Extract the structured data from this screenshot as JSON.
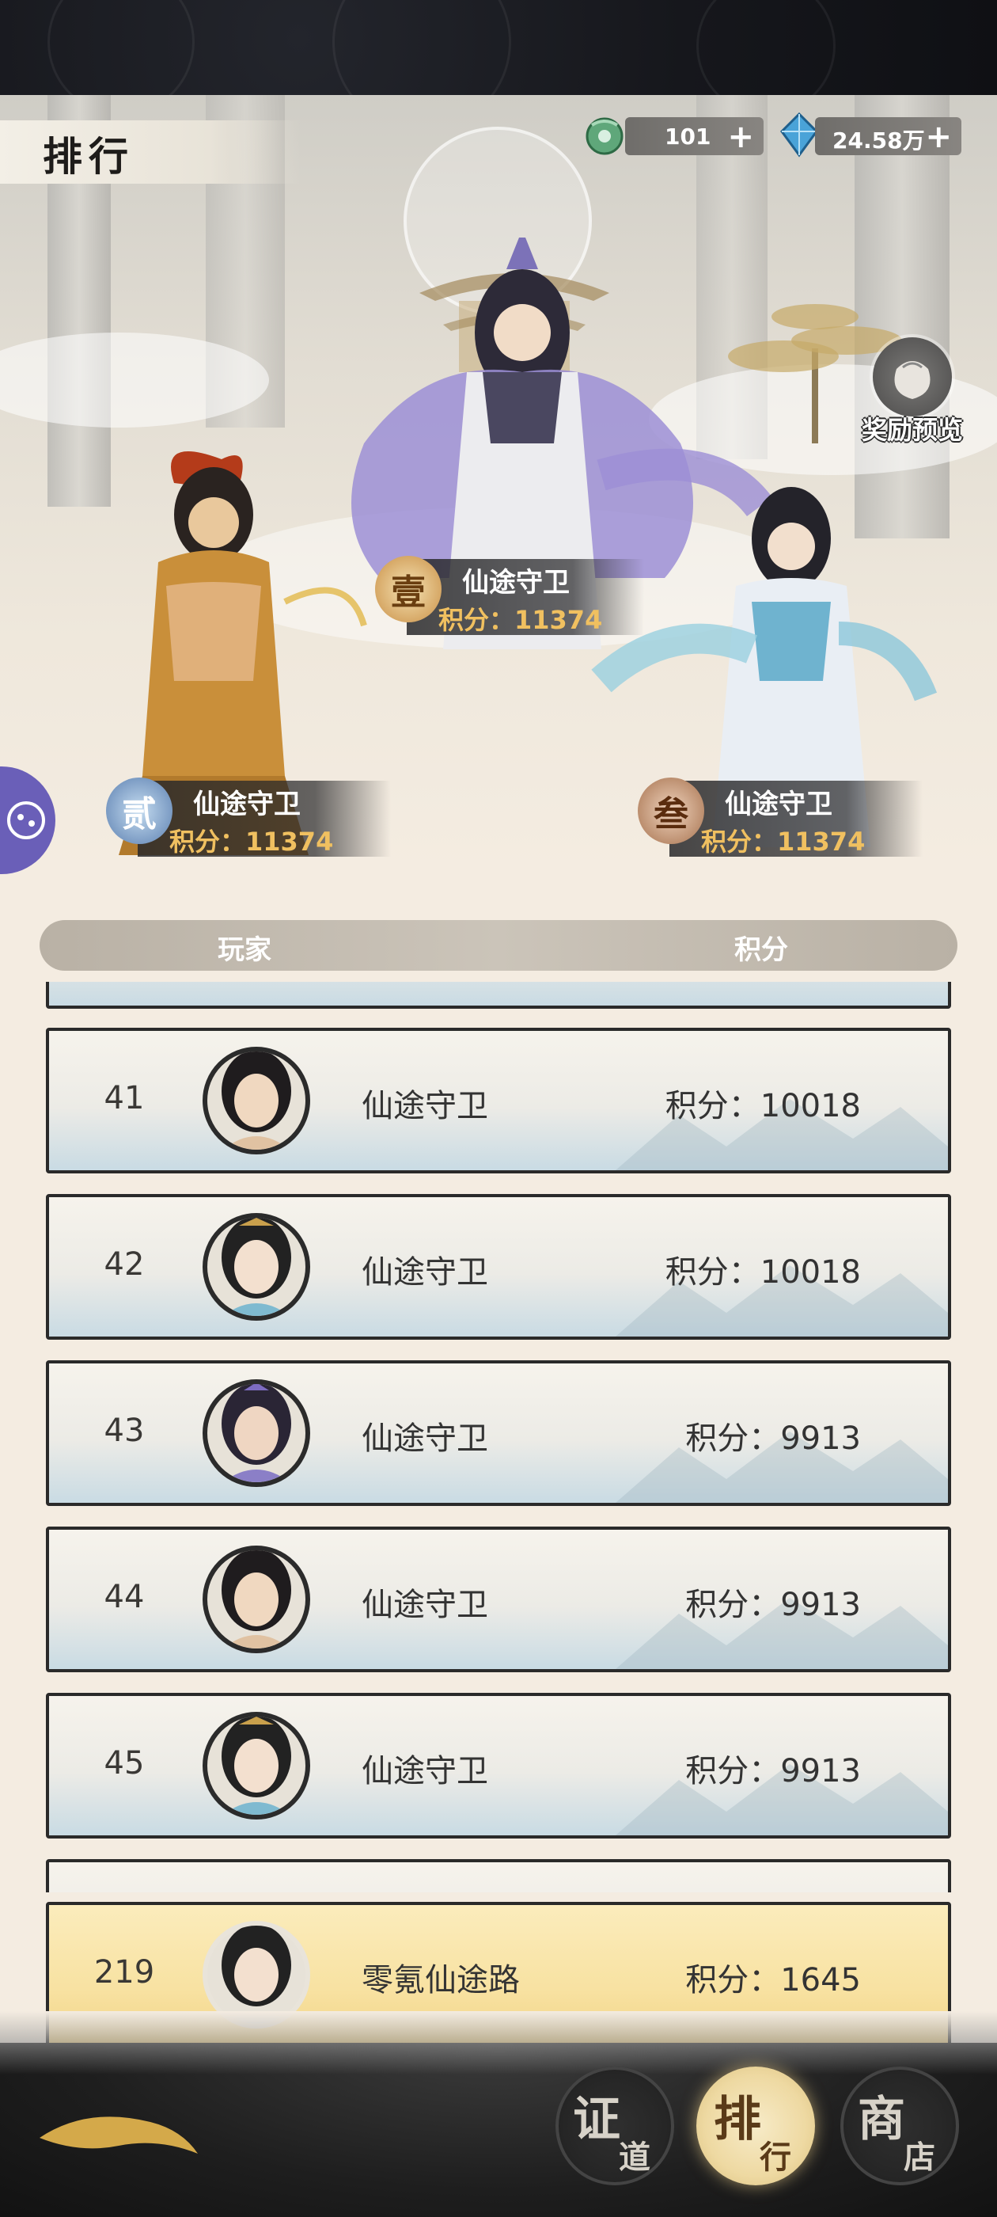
{
  "screen": {
    "title": "排行"
  },
  "currencies": [
    {
      "icon": "jade-coin-icon",
      "value": "101",
      "plus": "+"
    },
    {
      "icon": "spirit-crystal-icon",
      "value": "24.58万",
      "plus": "+"
    }
  ],
  "reward_preview": {
    "label": "奖励预览",
    "icon": "reward-bag-icon"
  },
  "podium": [
    {
      "rank_glyph": "壹",
      "name": "仙途守卫",
      "score": "积分：11374"
    },
    {
      "rank_glyph": "贰",
      "name": "仙途守卫",
      "score": "积分：11374"
    },
    {
      "rank_glyph": "叁",
      "name": "仙途守卫",
      "score": "积分：11374"
    }
  ],
  "list_header": {
    "player": "玩家",
    "score": "积分"
  },
  "rows": [
    {
      "rank": "41",
      "name": "仙途守卫",
      "score": "积分：10018"
    },
    {
      "rank": "42",
      "name": "仙途守卫",
      "score": "积分：10018"
    },
    {
      "rank": "43",
      "name": "仙途守卫",
      "score": "积分：9913"
    },
    {
      "rank": "44",
      "name": "仙途守卫",
      "score": "积分：9913"
    },
    {
      "rank": "45",
      "name": "仙途守卫",
      "score": "积分：9913"
    }
  ],
  "my_rank": {
    "rank": "219",
    "name": "零氪仙途路",
    "score": "积分：1645"
  },
  "nav": [
    {
      "big": "证",
      "small": "道",
      "active": false
    },
    {
      "big": "排",
      "small": "行",
      "active": true
    },
    {
      "big": "商",
      "small": "店",
      "active": false
    }
  ],
  "colors": {
    "accent_gold": "#f0c060",
    "my_row": "#f8e2a2",
    "background": "#f4ece1",
    "side_tab": "#6a5fb8"
  }
}
